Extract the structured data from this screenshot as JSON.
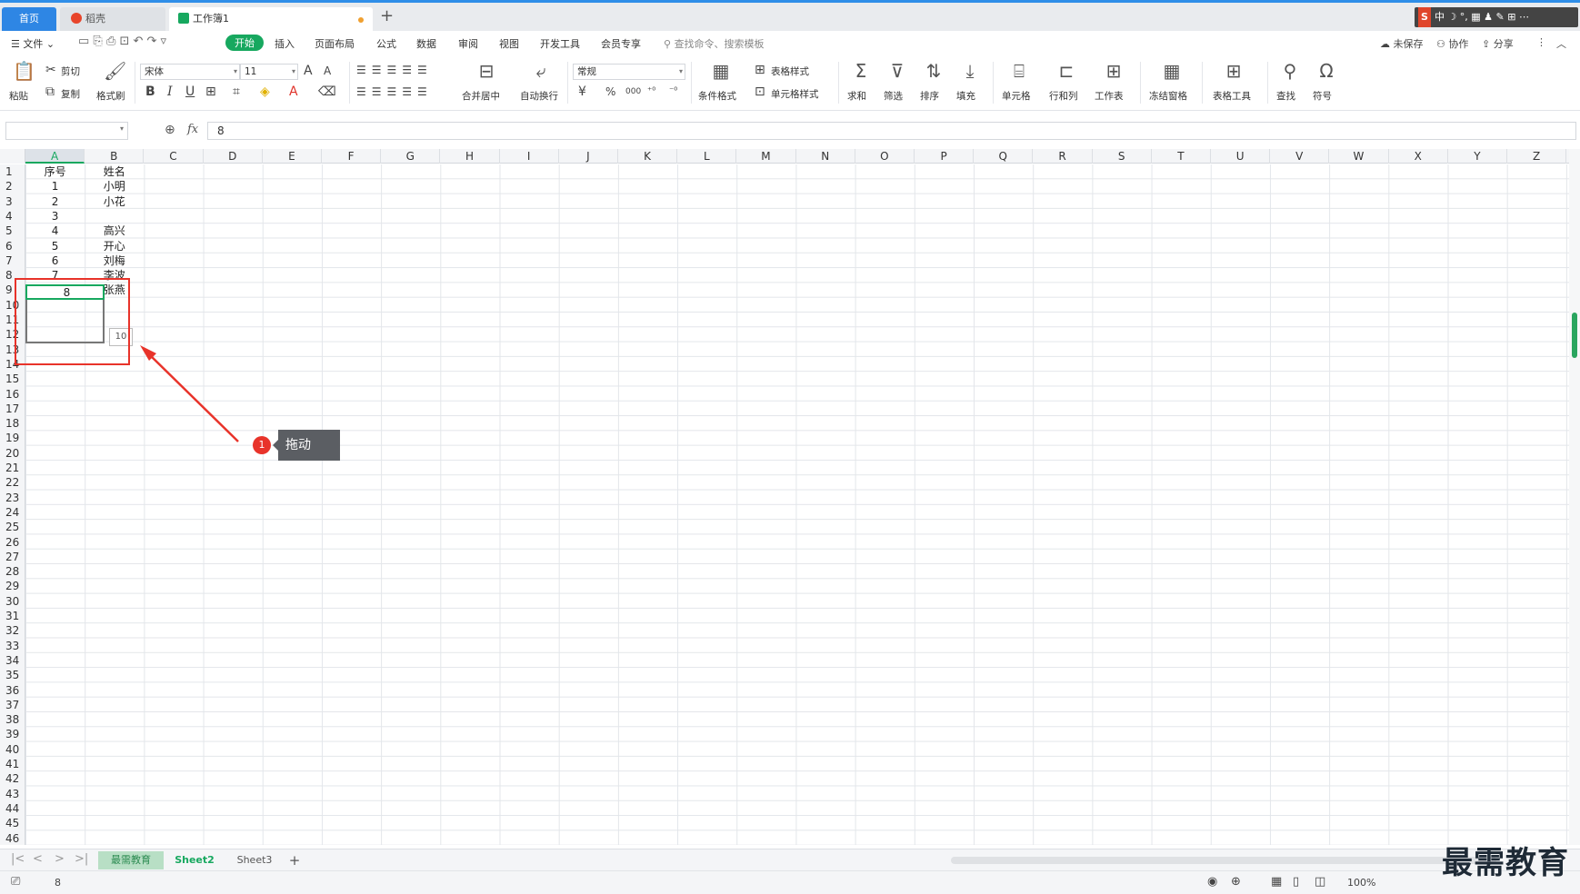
{
  "tabs": {
    "home": "首页",
    "daoke": "稻壳",
    "workbook": "工作簿1",
    "new_tab": "+"
  },
  "ime": {
    "logo": "S",
    "text": "中 ☽ °, ▦ ♟ ✎ ⊞ ⋯"
  },
  "menu": {
    "file": "文件",
    "items": [
      "开始",
      "插入",
      "页面布局",
      "公式",
      "数据",
      "审阅",
      "视图",
      "开发工具",
      "会员专享"
    ],
    "search_placeholder": "查找命令、搜索模板",
    "unsaved": "未保存",
    "collab": "协作",
    "share": "分享"
  },
  "ribbon": {
    "paste": "粘贴",
    "cut": "剪切",
    "copy": "复制",
    "format_painter": "格式刷",
    "font_name": "宋体",
    "font_size": "11",
    "merge_center": "合并居中",
    "wrap_text": "自动换行",
    "number_format": "常规",
    "cond_format": "条件格式",
    "table_style": "表格样式",
    "cell_style": "单元格样式",
    "sum": "求和",
    "filter": "筛选",
    "sort": "排序",
    "fill": "填充",
    "cell": "单元格",
    "row_col": "行和列",
    "worksheet": "工作表",
    "freeze": "冻结窗格",
    "table_tools": "表格工具",
    "find": "查找",
    "symbol": "符号",
    "currency": "¥",
    "percent": "%",
    "thousands": "000"
  },
  "formula": {
    "name_box": "",
    "fx": "fx",
    "value": "8"
  },
  "columns": [
    "A",
    "B",
    "C",
    "D",
    "E",
    "F",
    "G",
    "H",
    "I",
    "J",
    "K",
    "L",
    "M",
    "N",
    "O",
    "P",
    "Q",
    "R",
    "S",
    "T",
    "U",
    "V",
    "W",
    "X",
    "Y",
    "Z"
  ],
  "rows": [
    "1",
    "2",
    "3",
    "4",
    "5",
    "6",
    "7",
    "8",
    "9",
    "10",
    "11",
    "12",
    "13",
    "14",
    "15",
    "16",
    "17",
    "18",
    "19",
    "20",
    "21",
    "22",
    "23",
    "24",
    "25",
    "26",
    "27",
    "28",
    "29",
    "30",
    "31",
    "32",
    "33",
    "34",
    "35",
    "36",
    "37",
    "38",
    "39",
    "40",
    "41",
    "42",
    "43",
    "44",
    "45",
    "46"
  ],
  "cells": {
    "A": [
      "序号",
      "1",
      "2",
      "3",
      "4",
      "5",
      "6",
      "7",
      "8"
    ],
    "B": [
      "姓名",
      "小明",
      "小花",
      "",
      "高兴",
      "开心",
      "刘梅",
      "李波",
      "张燕"
    ]
  },
  "drag_tooltip": "10",
  "callout": {
    "number": "1",
    "text": "拖动"
  },
  "sheets": [
    "最需教育",
    "Sheet2",
    "Sheet3"
  ],
  "add_sheet": "+",
  "status": {
    "value": "8",
    "zoom": "100%"
  },
  "watermark": "最需教育",
  "colors": {
    "accent": "#17a85f",
    "annotation": "#e8332a"
  }
}
